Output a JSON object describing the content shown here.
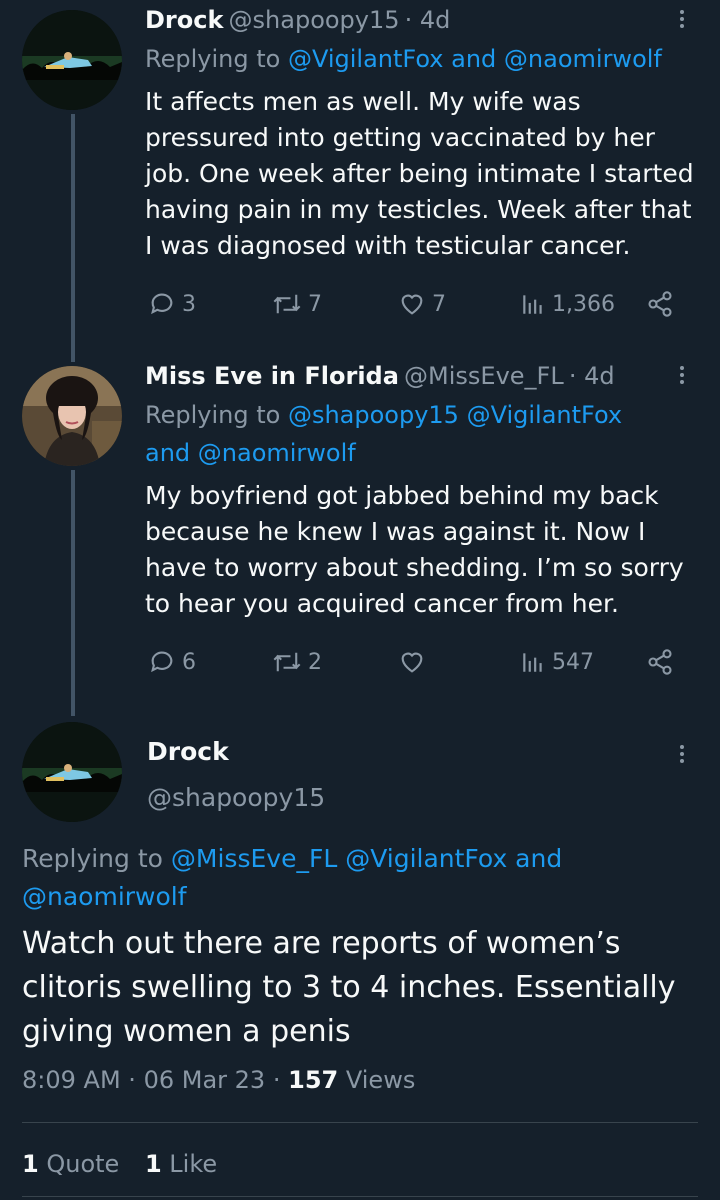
{
  "tweets": [
    {
      "name": "Drock",
      "handle": "@shapoopy15",
      "time": "· 4d",
      "replying_prefix": "Replying to",
      "replying_line1": "@VigilantFox and @naomirwolf",
      "replying_line2": "",
      "body_lines": [
        "It affects men as well. My wife was",
        "pressured into getting vaccinated by her",
        "job. One week after being intimate I started",
        "having pain in my testicles. Week after that",
        "I was diagnosed with testicular cancer."
      ],
      "replies": "3",
      "retweets": "7",
      "likes": "7",
      "views": "1,366"
    },
    {
      "name": "Miss Eve in Florida",
      "handle": "@MissEve_FL",
      "time": "· 4d",
      "replying_prefix": "Replying to",
      "replying_line1": "@shapoopy15 @VigilantFox",
      "replying_line2": "and @naomirwolf",
      "body_lines": [
        "My boyfriend got jabbed behind my back",
        "because he knew I was against it. Now I",
        "have to worry about shedding. I’m so sorry",
        "to hear you acquired cancer from her."
      ],
      "replies": "6",
      "retweets": "2",
      "likes": "",
      "views": "547"
    }
  ],
  "main_tweet": {
    "name": "Drock",
    "handle": "@shapoopy15",
    "replying_prefix": "Replying to",
    "replying_line1": "@MissEve_FL @VigilantFox and",
    "replying_line2": "@naomirwolf",
    "body_lines": [
      "Watch out there are reports of women’s",
      "clitoris swelling to 3 to 4 inches. Essentially",
      "giving women a penis"
    ],
    "time": "8:09 AM",
    "date": "06 Mar 23",
    "views_count": "157",
    "views_label": "Views",
    "quotes_count": "1",
    "quotes_label": "Quote",
    "likes_count": "1",
    "likes_label": "Like"
  },
  "colors": {
    "background": "#15202b",
    "text": "#f7f9f9",
    "muted": "#8b98a5",
    "link": "#1d9bf0",
    "thread_line": "#425466"
  },
  "icons": [
    "reply-icon",
    "retweet-icon",
    "like-icon",
    "views-icon",
    "share-icon",
    "more-icon"
  ]
}
